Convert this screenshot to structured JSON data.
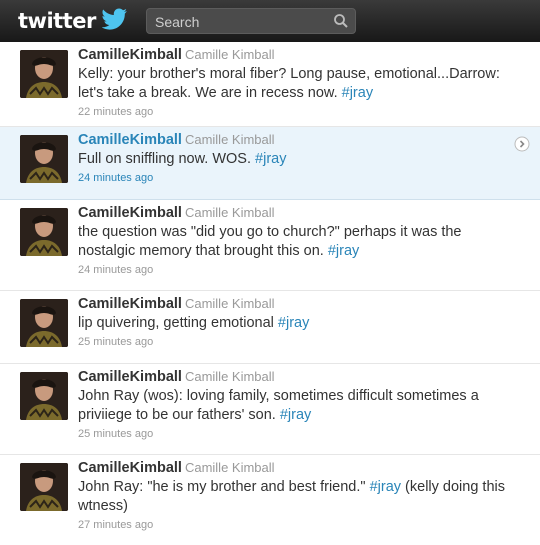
{
  "header": {
    "logo": "twitter",
    "search_placeholder": "Search"
  },
  "tweets": [
    {
      "screen_name": "CamilleKimball",
      "full_name": "Camille Kimball",
      "text": "Kelly: your brother's moral fiber? Long pause, emotional...Darrow: let's take a break. We are in recess now. ",
      "hashtag": "#jray",
      "tail": "",
      "time": "22 minutes ago"
    },
    {
      "screen_name": "CamilleKimball",
      "full_name": "Camille Kimball",
      "text": "Full on sniffling now. WOS. ",
      "hashtag": "#jray",
      "tail": "",
      "time": "24 minutes ago"
    },
    {
      "screen_name": "CamilleKimball",
      "full_name": "Camille Kimball",
      "text": "the question was \"did you go to church?\" perhaps it was the nostalgic memory that brought this on. ",
      "hashtag": "#jray",
      "tail": "",
      "time": "24 minutes ago"
    },
    {
      "screen_name": "CamilleKimball",
      "full_name": "Camille Kimball",
      "text": "lip quivering, getting emotional ",
      "hashtag": "#jray",
      "tail": "",
      "time": "25 minutes ago"
    },
    {
      "screen_name": "CamilleKimball",
      "full_name": "Camille Kimball",
      "text": "John Ray (wos): loving family, sometimes difficult sometimes a priviiege to be our fathers' son. ",
      "hashtag": "#jray",
      "tail": "",
      "time": "25 minutes ago"
    },
    {
      "screen_name": "CamilleKimball",
      "full_name": "Camille Kimball",
      "text": "John Ray: \"he is my brother and best friend.\" ",
      "hashtag": "#jray",
      "tail": " (kelly doing this wtness)",
      "time": "27 minutes ago"
    }
  ]
}
